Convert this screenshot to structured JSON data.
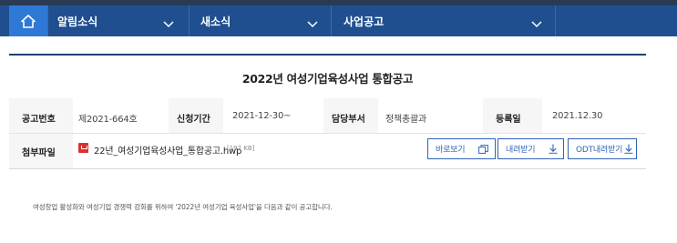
{
  "nav": {
    "home_label": "home",
    "menus": [
      {
        "label": "알림소식"
      },
      {
        "label": "새소식"
      },
      {
        "label": "사업공고"
      }
    ]
  },
  "notice": {
    "title": "2022년 여성기업육성사업 통합공고",
    "fields": {
      "notice_no_label": "공고번호",
      "notice_no": "제2021-664호",
      "period_label": "신청기간",
      "period": "2021-12-30~",
      "dept_label": "담당부서",
      "dept": "정책총괄과",
      "reg_label": "등록일",
      "reg_date": "2021.12.30",
      "attach_label": "첨부파일"
    },
    "attachment": {
      "icon": "hwp-file-icon",
      "name": "22년_여성기업육성사업_통합공고.hwp",
      "size": "[192 KB]"
    },
    "buttons": {
      "view": "바로보기",
      "download": "내려받기",
      "odt": "ODT내려받기"
    },
    "body": "여성창업 활성화와 여성기업 경쟁력 강화를 위하여 '2022년 여성기업 육성사업'을 다음과 같이 공고합니다."
  },
  "colors": {
    "nav_bg": "#1f4f8f",
    "home_bg": "#2f79d6",
    "accent": "#2f65b4",
    "file_icon": "#d9322f"
  }
}
